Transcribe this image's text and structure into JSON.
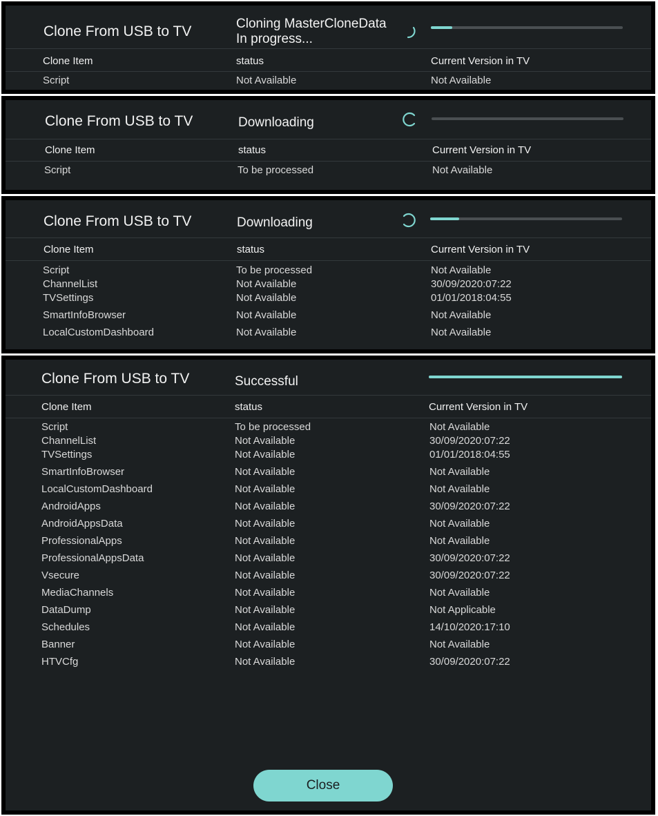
{
  "columns": {
    "item": "Clone Item",
    "status": "status",
    "version": "Current Version in TV"
  },
  "title": "Clone From USB to TV",
  "panel1": {
    "status_line1": "Cloning  MasterCloneData",
    "status_line2": "In progress...",
    "progress": 0.11,
    "rows": [
      {
        "item": "Script",
        "status": "Not Available",
        "version": "Not Available"
      }
    ]
  },
  "panel2": {
    "status": "Downloading",
    "progress": 0.0,
    "rows": [
      {
        "item": "Script",
        "status": "To be processed",
        "version": "Not Available"
      }
    ]
  },
  "panel3": {
    "status": "Downloading",
    "progress": 0.15,
    "rows": [
      {
        "item": "Script",
        "status": "To be processed",
        "version": "Not Available"
      },
      {
        "item": "ChannelList",
        "status": "Not Available",
        "version": "30/09/2020:07:22"
      },
      {
        "item": "TVSettings",
        "status": "Not Available",
        "version": "01/01/2018:04:55"
      },
      {
        "item": "SmartInfoBrowser",
        "status": "Not Available",
        "version": "Not Available"
      },
      {
        "item": "LocalCustomDashboard",
        "status": "Not Available",
        "version": "Not Available"
      }
    ]
  },
  "panel4": {
    "status": "Successful",
    "progress": 1.0,
    "close_label": "Close",
    "rows": [
      {
        "item": "Script",
        "status": "To be processed",
        "version": "Not Available"
      },
      {
        "item": "ChannelList",
        "status": "Not Available",
        "version": "30/09/2020:07:22"
      },
      {
        "item": "TVSettings",
        "status": "Not Available",
        "version": "01/01/2018:04:55"
      },
      {
        "item": "SmartInfoBrowser",
        "status": "Not Available",
        "version": "Not Available"
      },
      {
        "item": "LocalCustomDashboard",
        "status": "Not Available",
        "version": "Not Available"
      },
      {
        "item": "AndroidApps",
        "status": "Not Available",
        "version": "30/09/2020:07:22"
      },
      {
        "item": "AndroidAppsData",
        "status": "Not Available",
        "version": "Not Available"
      },
      {
        "item": "ProfessionalApps",
        "status": "Not Available",
        "version": "Not Available"
      },
      {
        "item": "ProfessionalAppsData",
        "status": "Not Available",
        "version": "30/09/2020:07:22"
      },
      {
        "item": "Vsecure",
        "status": "Not Available",
        "version": "30/09/2020:07:22"
      },
      {
        "item": "MediaChannels",
        "status": "Not Available",
        "version": "Not Available"
      },
      {
        "item": "DataDump",
        "status": "Not Available",
        "version": "Not Applicable"
      },
      {
        "item": "Schedules",
        "status": "Not Available",
        "version": "14/10/2020:17:10"
      },
      {
        "item": "Banner",
        "status": "Not Available",
        "version": "Not Available"
      },
      {
        "item": "HTVCfg",
        "status": "Not Available",
        "version": "30/09/2020:07:22"
      }
    ]
  },
  "colors": {
    "accent": "#7fd6d0",
    "panel_bg": "#1c2022",
    "track": "#4a4f52"
  }
}
